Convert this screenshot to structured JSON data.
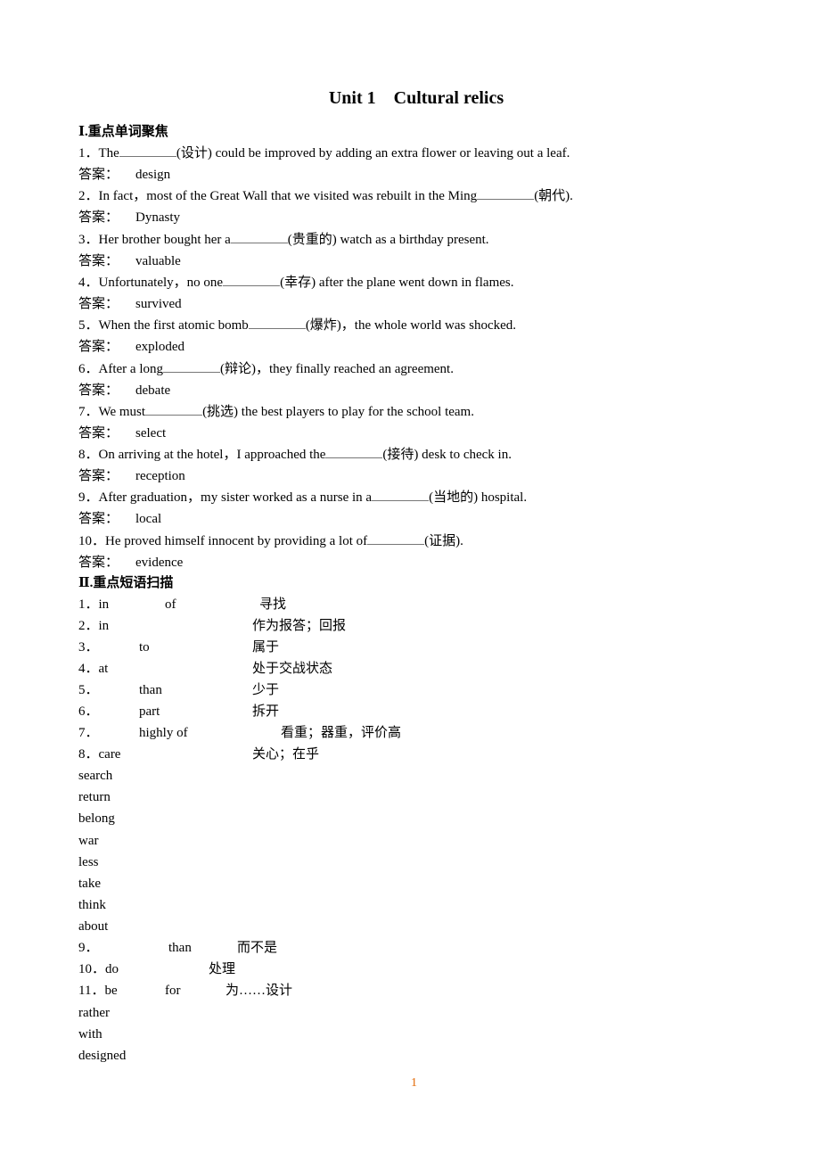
{
  "title": "Unit 1    Cultural relics",
  "section1": {
    "heading": "Ⅰ.重点单词聚焦",
    "answer_label": "答案：",
    "items": [
      {
        "num": "1．",
        "pre": "The",
        "post": "(设计) could be improved by adding an extra flower or leaving out a leaf.",
        "answer": "design"
      },
      {
        "num": "2．",
        "pre": "In fact，most of the Great Wall that we visited was rebuilt in the Ming",
        "post": "(朝代).",
        "answer": "Dynasty"
      },
      {
        "num": "3．",
        "pre": "Her brother bought her a",
        "post": "(贵重的) watch as a birthday present.",
        "answer": "valuable"
      },
      {
        "num": "4．",
        "pre": "Unfortunately，no one",
        "post": "(幸存) after the plane went down in flames.",
        "answer": "survived"
      },
      {
        "num": "5．",
        "pre": "When the first atomic bomb",
        "post": "(爆炸)，the whole world was shocked.",
        "answer": "exploded"
      },
      {
        "num": "6．",
        "pre": "After a long",
        "post": "(辩论)，they finally reached an agreement.",
        "answer": "debate"
      },
      {
        "num": "7．",
        "pre": "We must",
        "post": "(挑选) the best players to play for the school team.",
        "answer": "select"
      },
      {
        "num": "8．",
        "pre": "On arriving at the hotel，I approached the",
        "post": "(接待) desk to check in.",
        "answer": "reception"
      },
      {
        "num": "9．",
        "pre": "After graduation，my sister worked as a nurse in a",
        "post": "(当地的) hospital.",
        "answer": "local"
      },
      {
        "num": "10．",
        "pre": "He proved himself innocent by providing a lot of",
        "post": "(证据).",
        "answer": "evidence"
      }
    ]
  },
  "section2": {
    "heading": "Ⅱ.重点短语扫描",
    "phrases": [
      {
        "num": "1．in",
        "mid": "of",
        "cn": "寻找"
      },
      {
        "num": "2．in",
        "mid": "",
        "cn": "作为报答；回报"
      },
      {
        "num": "3．",
        "mid": "to",
        "cn": "属于"
      },
      {
        "num": "4．at",
        "mid": "",
        "cn": "处于交战状态"
      },
      {
        "num": "5．",
        "mid": "than",
        "cn": "少于"
      },
      {
        "num": "6．",
        "mid": "part",
        "cn": "拆开"
      },
      {
        "num": "7．",
        "mid": "highly of",
        "cn": "看重；器重，评价高"
      },
      {
        "num": "8．care",
        "mid": "",
        "cn": "关心；在乎"
      }
    ],
    "answers_a": [
      "search",
      "return",
      "belong",
      "war",
      "less",
      "take",
      "think",
      "about"
    ],
    "phrases_b": [
      {
        "num": "9．",
        "mid": "than",
        "cn": "而不是"
      },
      {
        "num": "10．do",
        "mid": "",
        "cn": "处理"
      },
      {
        "num": "11．be",
        "mid": "for",
        "cn": "为……设计"
      }
    ],
    "answers_b": [
      "rather",
      "with",
      "designed"
    ]
  },
  "page_number": "1"
}
